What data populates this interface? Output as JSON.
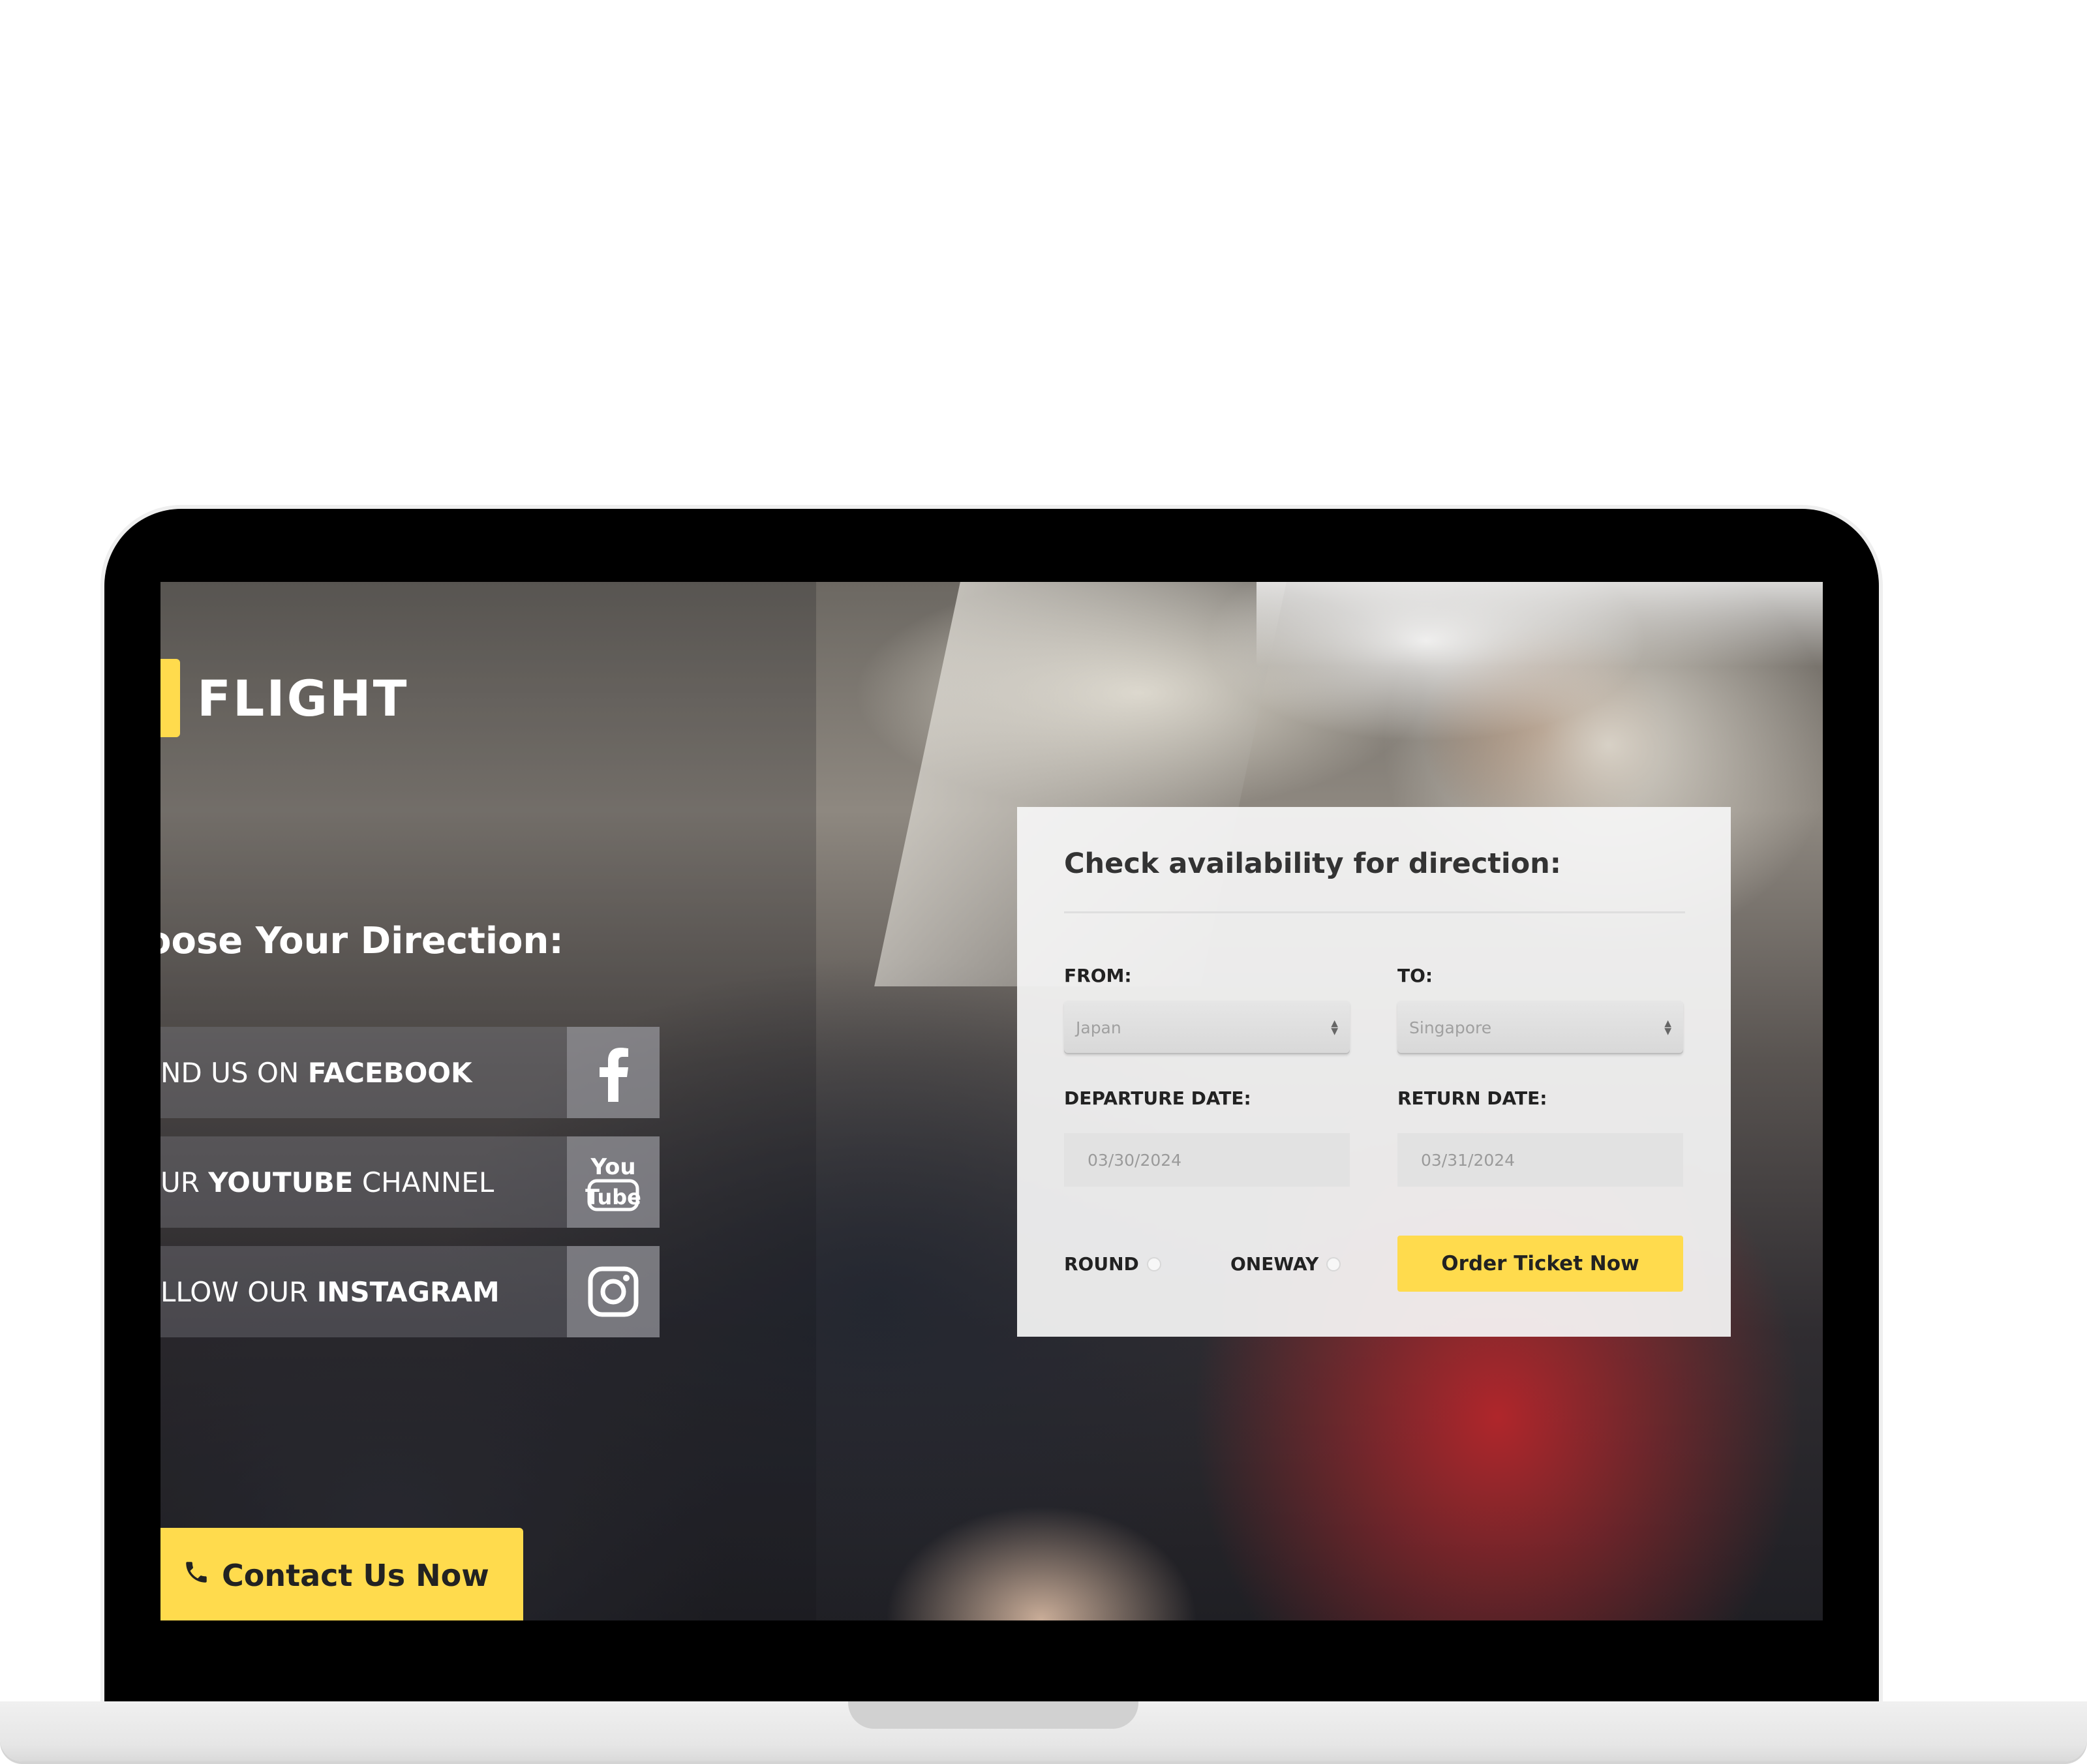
{
  "brand": {
    "logo_text": "FLIGHT",
    "accent_color": "#ffdb4d"
  },
  "left": {
    "direction_title": "oose Your Direction:",
    "social": [
      {
        "prefix": "ND US ON ",
        "bold": "FACEBOOK",
        "suffix": "",
        "icon": "facebook-icon"
      },
      {
        "prefix": "UR ",
        "bold": "YOUTUBE",
        "suffix": " CHANNEL",
        "icon": "youtube-icon"
      },
      {
        "prefix": "LLOW OUR ",
        "bold": "INSTAGRAM",
        "suffix": "",
        "icon": "instagram-icon"
      }
    ],
    "contact_label": "Contact Us Now",
    "contact_icon": "phone-icon"
  },
  "booking": {
    "title": "Check availability for direction:",
    "from_label": "FROM:",
    "from_value": "Japan",
    "to_label": "TO:",
    "to_value": "Singapore",
    "departure_label": "DEPARTURE DATE:",
    "departure_value": "03/30/2024",
    "return_label": "RETURN DATE:",
    "return_value": "03/31/2024",
    "round_label": "ROUND",
    "oneway_label": "ONEWAY",
    "order_label": "Order Ticket Now"
  }
}
